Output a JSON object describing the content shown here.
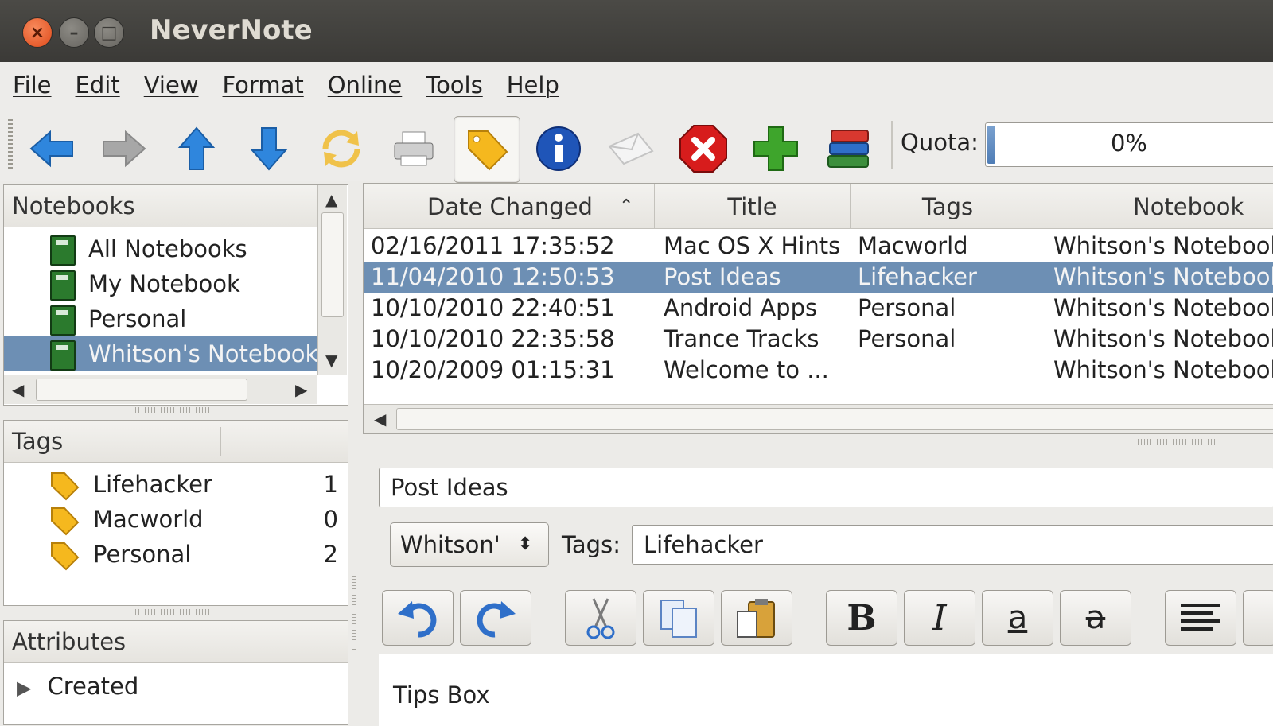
{
  "window": {
    "title": "NeverNote"
  },
  "menu": [
    "File",
    "Edit",
    "View",
    "Format",
    "Online",
    "Tools",
    "Help"
  ],
  "toolbar": {
    "buttons": [
      "back-icon",
      "forward-icon",
      "up-icon",
      "down-icon",
      "sync-icon",
      "print-icon",
      "tag-icon",
      "info-icon",
      "email-icon",
      "delete-icon",
      "add-icon",
      "notebooks-icon"
    ],
    "quota_label": "Quota:",
    "quota_value": "0%",
    "quota_fraction": 0.0
  },
  "notebooks": {
    "header": "Notebooks",
    "items": [
      "All Notebooks",
      "My Notebook",
      "Personal",
      "Whitson's Notebook"
    ],
    "selected_index": 3
  },
  "tags": {
    "header": "Tags",
    "items": [
      {
        "name": "Lifehacker",
        "count": "1"
      },
      {
        "name": "Macworld",
        "count": "0"
      },
      {
        "name": "Personal",
        "count": "2"
      }
    ]
  },
  "attributes": {
    "header": "Attributes",
    "items": [
      "Created"
    ]
  },
  "note_list": {
    "columns": [
      "Date Changed",
      "Title",
      "Tags",
      "Notebook"
    ],
    "rows": [
      {
        "date": "02/16/2011 17:35:52",
        "title": "Mac OS X Hints",
        "tags": "Macworld",
        "notebook": "Whitson's Notebook"
      },
      {
        "date": "11/04/2010 12:50:53",
        "title": "Post Ideas",
        "tags": "Lifehacker",
        "notebook": "Whitson's Notebook"
      },
      {
        "date": "10/10/2010 22:40:51",
        "title": "Android Apps",
        "tags": "Personal",
        "notebook": "Whitson's Notebook"
      },
      {
        "date": "10/10/2010 22:35:58",
        "title": "Trance Tracks",
        "tags": "Personal",
        "notebook": "Whitson's Notebook"
      },
      {
        "date": "10/20/2009 01:15:31",
        "title": "Welcome to ...",
        "tags": "",
        "notebook": "Whitson's Notebook"
      }
    ],
    "selected_index": 1
  },
  "editor": {
    "title_value": "Post Ideas",
    "notebook_value": "Whitson's Notebook",
    "tags_label": "Tags:",
    "tags_value": "Lifehacker",
    "body_first_line": "Tips Box",
    "format_buttons": [
      "undo-icon",
      "redo-icon",
      "cut-icon",
      "copy-icon",
      "paste-icon",
      "bold-icon",
      "italic-icon",
      "underline-icon",
      "strikethrough-icon",
      "align-left-icon"
    ]
  },
  "colors": {
    "selection": "#6d8fb4",
    "titlebar": "#3c3b37",
    "accent_blue": "#2f7fd6"
  }
}
